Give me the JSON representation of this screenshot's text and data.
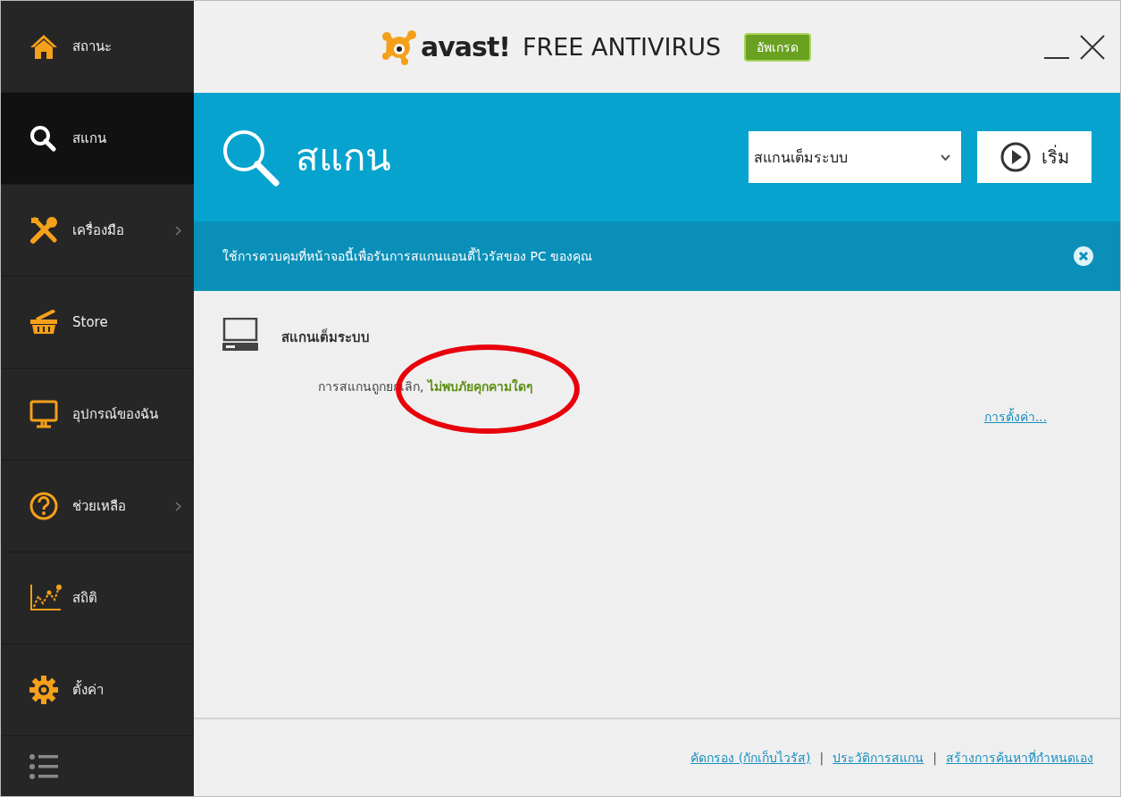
{
  "sidebar": {
    "items": [
      {
        "label": "สถานะ",
        "selected": false,
        "has_submenu": false
      },
      {
        "label": "สแกน",
        "selected": true,
        "has_submenu": false
      },
      {
        "label": "เครื่องมือ",
        "selected": false,
        "has_submenu": true
      },
      {
        "label": "Store",
        "selected": false,
        "has_submenu": false
      },
      {
        "label": "อุปกรณ์ของฉัน",
        "selected": false,
        "has_submenu": false
      },
      {
        "label": "ช่วยเหลือ",
        "selected": false,
        "has_submenu": true
      },
      {
        "label": "สถิติ",
        "selected": false,
        "has_submenu": false
      },
      {
        "label": "ตั้งค่า",
        "selected": false,
        "has_submenu": false
      }
    ]
  },
  "header": {
    "logo": "avast!",
    "product": "FREE ANTIVIRUS",
    "upgrade_button": "อัพเกรด"
  },
  "scan_panel": {
    "title": "สแกน",
    "scan_type": "สแกนเต็มระบบ",
    "start_button": "เริ่ม"
  },
  "banner": {
    "text": "ใช้การควบคุมที่หน้าจอนี้เพื่อรันการสแกนแอนตี้ไวรัสของ PC ของคุณ"
  },
  "scan_item": {
    "title": "สแกนเต็มระบบ",
    "status": "การสแกนถูกยกเลิก,",
    "result": "ไม่พบภัยคุกคามใดๆ",
    "settings_link": "การตั้งค่า..."
  },
  "footer": {
    "links": [
      "คัดกรอง (กักเก็บไวรัส)",
      "ประวัติการสแกน",
      "สร้างการค้นหาที่กำหนดเอง"
    ],
    "separators": [
      "|",
      "|"
    ]
  }
}
